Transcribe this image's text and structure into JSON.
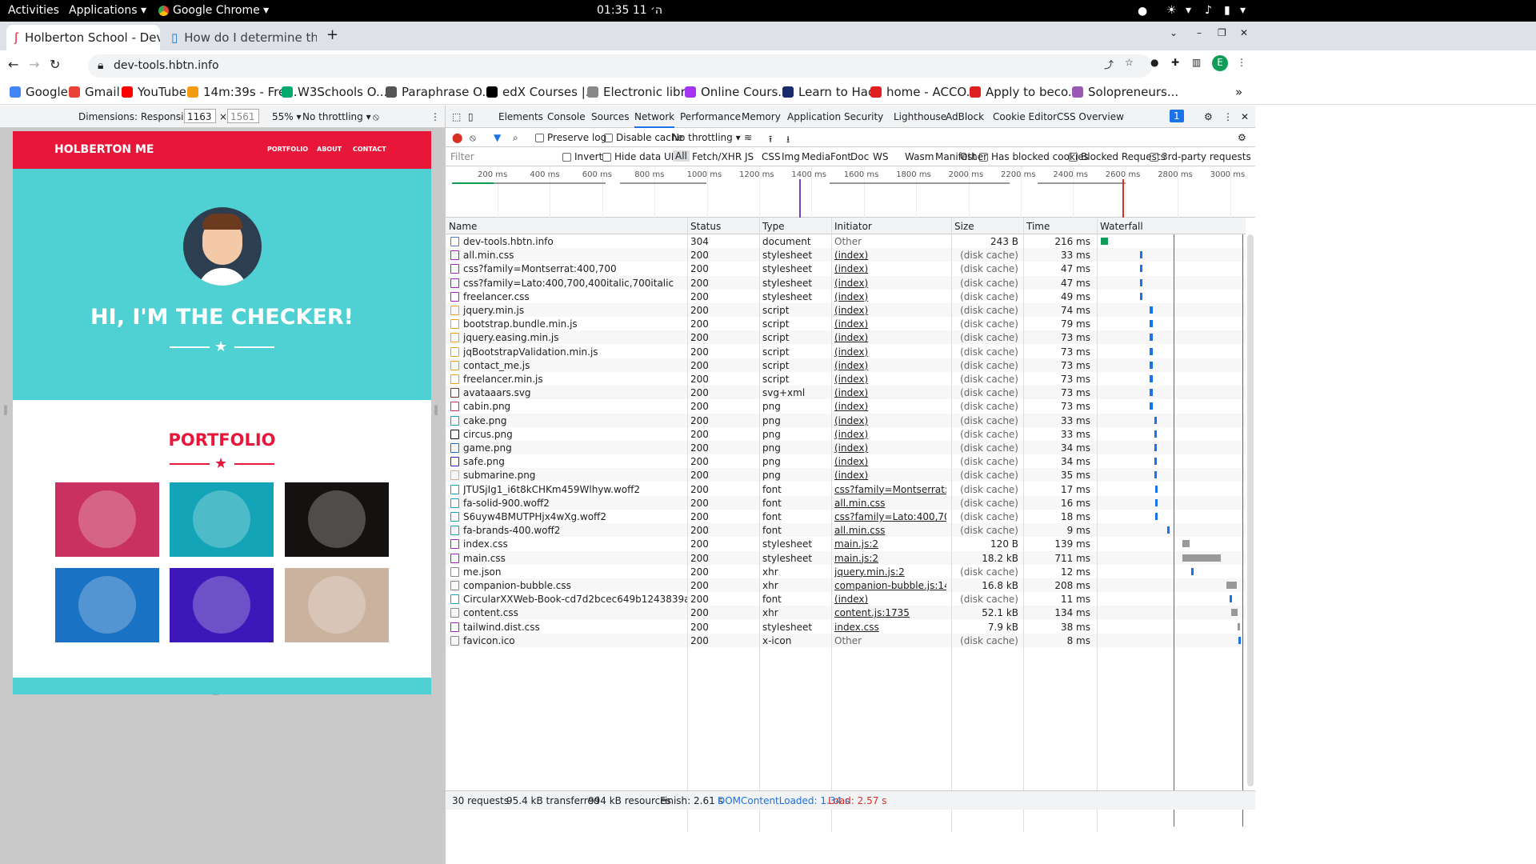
{
  "os": {
    "activities": "Activities",
    "applications": "Applications ▾",
    "chrome": "Google Chrome ▾",
    "clock": "ה׳ 11  01:35"
  },
  "tabs": [
    {
      "title": "Holberton School - Deve"
    },
    {
      "title": "How do I determine the"
    }
  ],
  "address": "dev-tools.hbtn.info",
  "bookmarks": [
    {
      "label": "Google",
      "color": "#4285f4"
    },
    {
      "label": "Gmail",
      "color": "#ea4335"
    },
    {
      "label": "YouTube",
      "color": "#ff0000"
    },
    {
      "label": "14m:39s - Fre...",
      "color": "#f39c12"
    },
    {
      "label": "W3Schools O...",
      "color": "#04aa6d"
    },
    {
      "label": "Paraphrase O...",
      "color": "#555555"
    },
    {
      "label": "edX Courses |...",
      "color": "#000000"
    },
    {
      "label": "Electronic libr...",
      "color": "#888888"
    },
    {
      "label": "Online Cours...",
      "color": "#a435f0"
    },
    {
      "label": "Learn to Hack",
      "color": "#1a2b6d"
    },
    {
      "label": "home - ACCO...",
      "color": "#e02020"
    },
    {
      "label": "Apply to beco...",
      "color": "#e02020"
    },
    {
      "label": "Solopreneurs...",
      "color": "#9b59b6"
    }
  ],
  "device_bar": {
    "dimensions": "Dimensions: Responsive ▾",
    "width": "1163",
    "height": "1561",
    "zoom": "55% ▾",
    "throttle": "No throttling ▾"
  },
  "page": {
    "brand": "HOLBERTON ME",
    "nav": [
      "PORTFOLIO",
      "ABOUT",
      "CONTACT"
    ],
    "hero": "HI, I'M THE CHECKER!",
    "portfolio": "PORTFOLIO",
    "colors": {
      "nav": "#e8173a",
      "hero": "#4fd1d3"
    },
    "items": [
      {
        "name": "cabin",
        "bg": "#c93160"
      },
      {
        "name": "cake",
        "bg": "#13a5b7"
      },
      {
        "name": "circus",
        "bg": "#161111"
      },
      {
        "name": "game",
        "bg": "#1a72c4"
      },
      {
        "name": "safe",
        "bg": "#3d17b7"
      },
      {
        "name": "submarine",
        "bg": "#cbb29f"
      }
    ]
  },
  "devtools": {
    "tabs": [
      "Elements",
      "Console",
      "Sources",
      "Network",
      "Performance",
      "Memory",
      "Application",
      "Security",
      "Lighthouse",
      "AdBlock",
      "Cookie Editor",
      "CSS Overview"
    ],
    "active_tab": "Network",
    "toolbar": {
      "preserve": "Preserve log",
      "disable": "Disable cache",
      "throttle": "No throttling"
    },
    "filter": {
      "placeholder": "Filter",
      "invert": "Invert",
      "hide": "Hide data URLs",
      "types": [
        "All",
        "Fetch/XHR",
        "JS",
        "CSS",
        "Img",
        "Media",
        "Font",
        "Doc",
        "WS",
        "Wasm",
        "Manifest",
        "Other"
      ],
      "blocked_cookies": "Has blocked cookies",
      "blocked_requests": "Blocked Requests",
      "third_party": "3rd-party requests"
    },
    "ticks": [
      "200 ms",
      "400 ms",
      "600 ms",
      "800 ms",
      "1000 ms",
      "1200 ms",
      "1400 ms",
      "1600 ms",
      "1800 ms",
      "2000 ms",
      "2200 ms",
      "2400 ms",
      "2600 ms",
      "2800 ms",
      "3000 ms"
    ],
    "columns": [
      "Name",
      "Status",
      "Type",
      "Initiator",
      "Size",
      "Time",
      "Waterfall"
    ],
    "rows": [
      {
        "name": "dev-tools.hbtn.info",
        "status": "304",
        "type": "document",
        "initiator": "Other",
        "size": "243 B",
        "time": "216 ms",
        "icolor": "#4a7bd4",
        "wf": 0.005,
        "ww": 0.05,
        "wc": "#0f9d58"
      },
      {
        "name": "all.min.css",
        "status": "200",
        "type": "stylesheet",
        "initiator": "(index)",
        "size": "(disk cache)",
        "time": "33 ms",
        "icolor": "#a020c0",
        "wf": 0.28,
        "ww": 0.012,
        "wc": "#1a73e8"
      },
      {
        "name": "css?family=Montserrat:400,700",
        "status": "200",
        "type": "stylesheet",
        "initiator": "(index)",
        "size": "(disk cache)",
        "time": "47 ms",
        "icolor": "#a020c0",
        "wf": 0.28,
        "ww": 0.014,
        "wc": "#1a73e8"
      },
      {
        "name": "css?family=Lato:400,700,400italic,700italic",
        "status": "200",
        "type": "stylesheet",
        "initiator": "(index)",
        "size": "(disk cache)",
        "time": "47 ms",
        "icolor": "#a020c0",
        "wf": 0.28,
        "ww": 0.014,
        "wc": "#1a73e8"
      },
      {
        "name": "freelancer.css",
        "status": "200",
        "type": "stylesheet",
        "initiator": "(index)",
        "size": "(disk cache)",
        "time": "49 ms",
        "icolor": "#a020c0",
        "wf": 0.28,
        "ww": 0.014,
        "wc": "#1a73e8"
      },
      {
        "name": "jquery.min.js",
        "status": "200",
        "type": "script",
        "initiator": "(index)",
        "size": "(disk cache)",
        "time": "74 ms",
        "icolor": "#e8a317",
        "wf": 0.35,
        "ww": 0.02,
        "wc": "#1a73e8"
      },
      {
        "name": "bootstrap.bundle.min.js",
        "status": "200",
        "type": "script",
        "initiator": "(index)",
        "size": "(disk cache)",
        "time": "79 ms",
        "icolor": "#e8a317",
        "wf": 0.35,
        "ww": 0.02,
        "wc": "#1a73e8"
      },
      {
        "name": "jquery.easing.min.js",
        "status": "200",
        "type": "script",
        "initiator": "(index)",
        "size": "(disk cache)",
        "time": "73 ms",
        "icolor": "#e8a317",
        "wf": 0.35,
        "ww": 0.02,
        "wc": "#1a73e8"
      },
      {
        "name": "jqBootstrapValidation.min.js",
        "status": "200",
        "type": "script",
        "initiator": "(index)",
        "size": "(disk cache)",
        "time": "73 ms",
        "icolor": "#e8a317",
        "wf": 0.35,
        "ww": 0.02,
        "wc": "#1a73e8"
      },
      {
        "name": "contact_me.js",
        "status": "200",
        "type": "script",
        "initiator": "(index)",
        "size": "(disk cache)",
        "time": "73 ms",
        "icolor": "#e8a317",
        "wf": 0.35,
        "ww": 0.02,
        "wc": "#1a73e8"
      },
      {
        "name": "freelancer.min.js",
        "status": "200",
        "type": "script",
        "initiator": "(index)",
        "size": "(disk cache)",
        "time": "73 ms",
        "icolor": "#e8a317",
        "wf": 0.35,
        "ww": 0.02,
        "wc": "#1a73e8"
      },
      {
        "name": "avataaars.svg",
        "status": "200",
        "type": "svg+xml",
        "initiator": "(index)",
        "size": "(disk cache)",
        "time": "73 ms",
        "icolor": "#5b3a29",
        "wf": 0.35,
        "ww": 0.02,
        "wc": "#1a73e8"
      },
      {
        "name": "cabin.png",
        "status": "200",
        "type": "png",
        "initiator": "(index)",
        "size": "(disk cache)",
        "time": "73 ms",
        "icolor": "#c93160",
        "wf": 0.35,
        "ww": 0.02,
        "wc": "#1a73e8"
      },
      {
        "name": "cake.png",
        "status": "200",
        "type": "png",
        "initiator": "(index)",
        "size": "(disk cache)",
        "time": "33 ms",
        "icolor": "#13a5b7",
        "wf": 0.38,
        "ww": 0.01,
        "wc": "#1a73e8"
      },
      {
        "name": "circus.png",
        "status": "200",
        "type": "png",
        "initiator": "(index)",
        "size": "(disk cache)",
        "time": "33 ms",
        "icolor": "#161111",
        "wf": 0.38,
        "ww": 0.01,
        "wc": "#1a73e8"
      },
      {
        "name": "game.png",
        "status": "200",
        "type": "png",
        "initiator": "(index)",
        "size": "(disk cache)",
        "time": "34 ms",
        "icolor": "#1a72c4",
        "wf": 0.38,
        "ww": 0.01,
        "wc": "#1a73e8"
      },
      {
        "name": "safe.png",
        "status": "200",
        "type": "png",
        "initiator": "(index)",
        "size": "(disk cache)",
        "time": "34 ms",
        "icolor": "#3d17b7",
        "wf": 0.38,
        "ww": 0.01,
        "wc": "#1a73e8"
      },
      {
        "name": "submarine.png",
        "status": "200",
        "type": "png",
        "initiator": "(index)",
        "size": "(disk cache)",
        "time": "35 ms",
        "icolor": "#cbb29f",
        "wf": 0.38,
        "ww": 0.01,
        "wc": "#1a73e8"
      },
      {
        "name": "JTUSjIg1_i6t8kCHKm459Wlhyw.woff2",
        "status": "200",
        "type": "font",
        "initiator": "css?family=Montserrat:400,700",
        "size": "(disk cache)",
        "time": "17 ms",
        "icolor": "#13a5b7",
        "wf": 0.39,
        "ww": 0.008,
        "wc": "#1a73e8"
      },
      {
        "name": "fa-solid-900.woff2",
        "status": "200",
        "type": "font",
        "initiator": "all.min.css",
        "size": "(disk cache)",
        "time": "16 ms",
        "icolor": "#13a5b7",
        "wf": 0.39,
        "ww": 0.008,
        "wc": "#1a73e8"
      },
      {
        "name": "S6uyw4BMUTPHjx4wXg.woff2",
        "status": "200",
        "type": "font",
        "initiator": "css?family=Lato:400,700,400it...",
        "size": "(disk cache)",
        "time": "18 ms",
        "icolor": "#13a5b7",
        "wf": 0.39,
        "ww": 0.008,
        "wc": "#1a73e8"
      },
      {
        "name": "fa-brands-400.woff2",
        "status": "200",
        "type": "font",
        "initiator": "all.min.css",
        "size": "(disk cache)",
        "time": "9 ms",
        "icolor": "#13a5b7",
        "wf": 0.47,
        "ww": 0.006,
        "wc": "#1a73e8"
      },
      {
        "name": "index.css",
        "status": "200",
        "type": "stylesheet",
        "initiator": "main.js:2",
        "size": "120 B",
        "time": "139 ms",
        "icolor": "#a020c0",
        "wf": 0.58,
        "ww": 0.05,
        "wc": "#999999"
      },
      {
        "name": "main.css",
        "status": "200",
        "type": "stylesheet",
        "initiator": "main.js:2",
        "size": "18.2 kB",
        "time": "711 ms",
        "icolor": "#a020c0",
        "wf": 0.58,
        "ww": 0.27,
        "wc": "#999999"
      },
      {
        "name": "me.json",
        "status": "200",
        "type": "xhr",
        "initiator": "jquery.min.js:2",
        "size": "(disk cache)",
        "time": "12 ms",
        "icolor": "#888888",
        "wf": 0.64,
        "ww": 0.008,
        "wc": "#1a73e8"
      },
      {
        "name": "companion-bubble.css",
        "status": "200",
        "type": "xhr",
        "initiator": "companion-bubble.js:1419",
        "size": "16.8 kB",
        "time": "208 ms",
        "icolor": "#888888",
        "wf": 0.89,
        "ww": 0.07,
        "wc": "#999999"
      },
      {
        "name": "CircularXXWeb-Book-cd7d2bcec649b1243839a15d5eb8f0a3...",
        "status": "200",
        "type": "font",
        "initiator": "(index)",
        "size": "(disk cache)",
        "time": "11 ms",
        "icolor": "#13a5b7",
        "wf": 0.91,
        "ww": 0.008,
        "wc": "#1a73e8"
      },
      {
        "name": "content.css",
        "status": "200",
        "type": "xhr",
        "initiator": "content.js:1735",
        "size": "52.1 kB",
        "time": "134 ms",
        "icolor": "#888888",
        "wf": 0.92,
        "ww": 0.045,
        "wc": "#999999"
      },
      {
        "name": "tailwind.dist.css",
        "status": "200",
        "type": "stylesheet",
        "initiator": "index.css",
        "size": "7.9 kB",
        "time": "38 ms",
        "icolor": "#a020c0",
        "wf": 0.965,
        "ww": 0.01,
        "wc": "#999999"
      },
      {
        "name": "favicon.ico",
        "status": "200",
        "type": "x-icon",
        "initiator": "Other",
        "size": "(disk cache)",
        "time": "8 ms",
        "icolor": "#888888",
        "wf": 0.97,
        "ww": 0.005,
        "wc": "#1a73e8"
      }
    ],
    "status": {
      "requests": "30 requests",
      "transferred": "95.4 kB transferred",
      "resources": "994 kB resources",
      "finish": "Finish: 2.61 s",
      "dcl": "DOMContentLoaded: 1.34 s",
      "load": "Load: 2.57 s"
    }
  }
}
